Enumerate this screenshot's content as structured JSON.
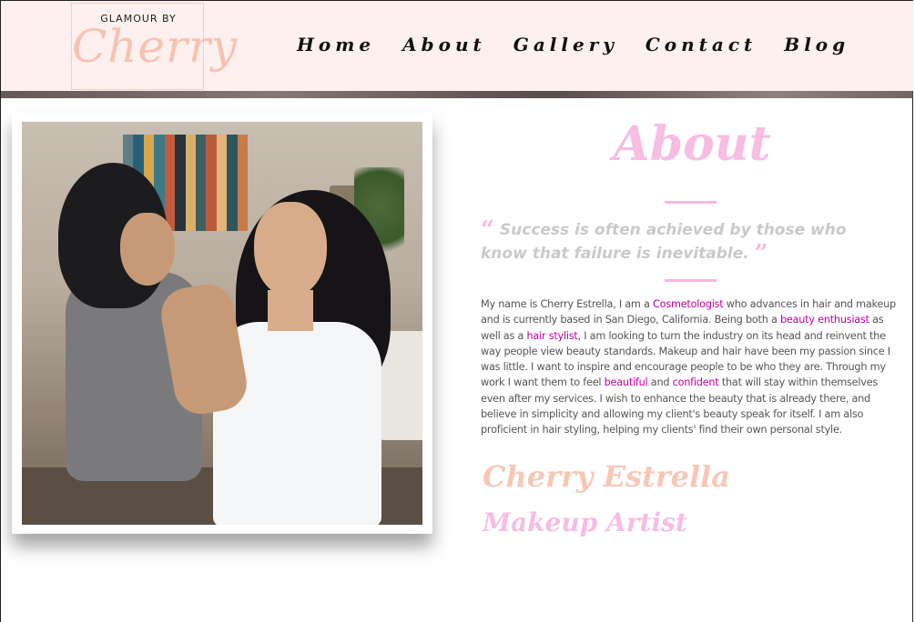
{
  "header": {
    "logo_top": "GLAMOUR BY",
    "logo_main": "Cherry",
    "nav": [
      "Home",
      "About",
      "Gallery",
      "Contact",
      "Blog"
    ]
  },
  "about": {
    "title": "About",
    "quote": "Success is often achieved by those who know that failure is inevitable.",
    "bio": {
      "p1": "My name is Cherry Estrella, I am a ",
      "h1": "Cosmetologist",
      "p2": " who advances in hair and makeup and is currently based in San Diego, California. Being both a ",
      "h2": "beauty enthusiast",
      "p3": " as well as a ",
      "h3": "hair stylist",
      "p4": ", I am looking to turn the industry on its head and reinvent the way people view beauty standards. Makeup and hair have been my passion since I was little. I want to inspire and encourage people to be who they are. Through my work I want them to feel ",
      "h4": "beautiful",
      "p5": " and ",
      "h5": "confident",
      "p6": " that will stay within themselves even after my services. I wish to enhance the beauty that is already there, and believe in simplicity and allowing my client's beauty speak for itself. I am also proficient in hair styling, helping my clients' find their own personal style."
    },
    "signature_name": "Cherry Estrella",
    "signature_role": "Makeup Artist"
  },
  "colors": {
    "header_bg": "#fdf0ee",
    "accent_pink": "#f7bde3",
    "accent_peach": "#f7c7b6",
    "highlight": "#c0009f"
  },
  "icons": [
    "open-quote-icon",
    "close-quote-icon"
  ]
}
